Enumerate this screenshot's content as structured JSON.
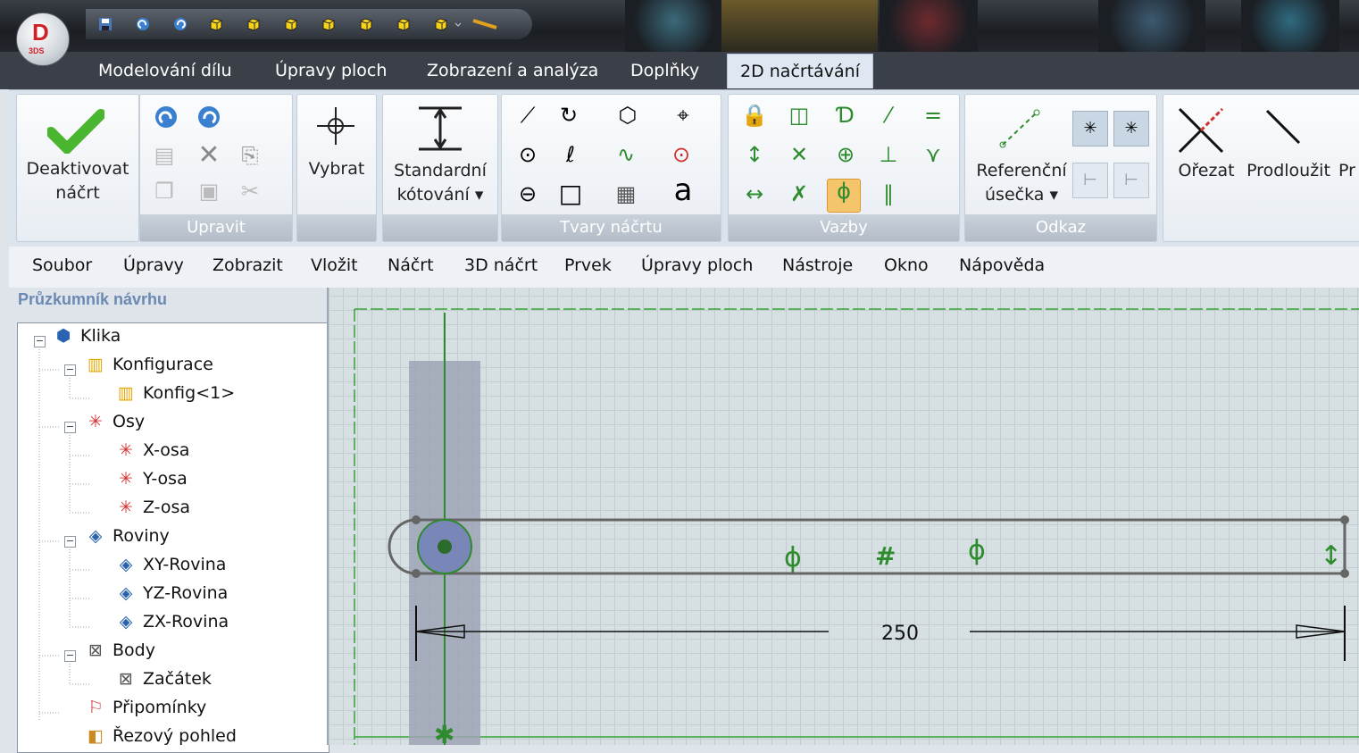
{
  "app": {
    "logo_letter": "D",
    "logo_sub": "3DS"
  },
  "tabs": [
    {
      "label": "Modelování dílu"
    },
    {
      "label": "Úpravy ploch"
    },
    {
      "label": "Zobrazení a analýza"
    },
    {
      "label": "Doplňky"
    },
    {
      "label": "2D načrtávání"
    }
  ],
  "ribbon": {
    "deactivate": {
      "line1": "Deaktivovat",
      "line2": "náčrt"
    },
    "edit_group": "Upravit",
    "select": "Vybrat",
    "dimension": {
      "line1": "Standardní",
      "line2": "kótování"
    },
    "shapes_group": "Tvary náčrtu",
    "text_tool_glyph": "a",
    "constraints_group": "Vazby",
    "refline": {
      "line1": "Referenční",
      "line2": "úsečka"
    },
    "reference_group": "Odkaz",
    "trim": "Ořezat",
    "extend": "Prodloužit",
    "cut_off": "Pr"
  },
  "menu": [
    "Soubor",
    "Úpravy",
    "Zobrazit",
    "Vložit",
    "Náčrt",
    "3D náčrt",
    "Prvek",
    "Úpravy ploch",
    "Nástroje",
    "Okno",
    "Nápověda"
  ],
  "explorer": {
    "title": "Průzkumník návrhu",
    "tree": [
      {
        "label": "Klika",
        "icon": "part-icon"
      },
      {
        "label": "Konfigurace",
        "icon": "config-icon"
      },
      {
        "label": "Konfig<1>",
        "icon": "config-icon"
      },
      {
        "label": "Osy",
        "icon": "axes-icon"
      },
      {
        "label": "X-osa",
        "icon": "axis-icon"
      },
      {
        "label": "Y-osa",
        "icon": "axis-icon"
      },
      {
        "label": "Z-osa",
        "icon": "axis-icon"
      },
      {
        "label": "Roviny",
        "icon": "plane-icon"
      },
      {
        "label": "XY-Rovina",
        "icon": "plane-icon"
      },
      {
        "label": "YZ-Rovina",
        "icon": "plane-icon"
      },
      {
        "label": "ZX-Rovina",
        "icon": "plane-icon"
      },
      {
        "label": "Body",
        "icon": "point-icon"
      },
      {
        "label": "Začátek",
        "icon": "point-icon"
      },
      {
        "label": "Připomínky",
        "icon": "annotation-icon"
      },
      {
        "label": "Řezový pohled",
        "icon": "section-icon"
      }
    ]
  },
  "sketch": {
    "dimension_value": "250"
  },
  "colors": {
    "accent_green": "#2e8b2e",
    "titlebar": "#1b1e23",
    "ribbon_bg": "#dbe3ec"
  }
}
